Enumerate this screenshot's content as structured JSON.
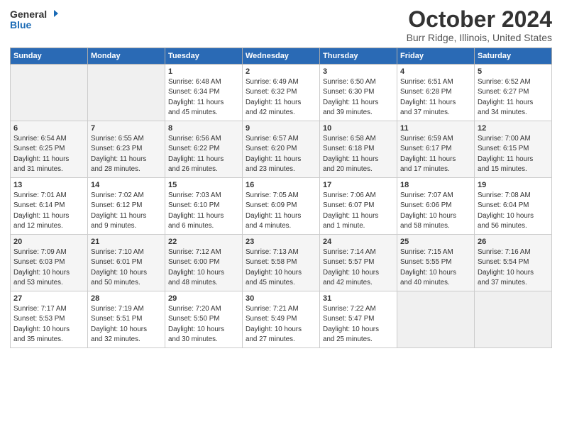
{
  "logo": {
    "line1": "General",
    "line2": "Blue"
  },
  "title": "October 2024",
  "location": "Burr Ridge, Illinois, United States",
  "days_of_week": [
    "Sunday",
    "Monday",
    "Tuesday",
    "Wednesday",
    "Thursday",
    "Friday",
    "Saturday"
  ],
  "weeks": [
    [
      {
        "num": "",
        "info": ""
      },
      {
        "num": "",
        "info": ""
      },
      {
        "num": "1",
        "info": "Sunrise: 6:48 AM\nSunset: 6:34 PM\nDaylight: 11 hours\nand 45 minutes."
      },
      {
        "num": "2",
        "info": "Sunrise: 6:49 AM\nSunset: 6:32 PM\nDaylight: 11 hours\nand 42 minutes."
      },
      {
        "num": "3",
        "info": "Sunrise: 6:50 AM\nSunset: 6:30 PM\nDaylight: 11 hours\nand 39 minutes."
      },
      {
        "num": "4",
        "info": "Sunrise: 6:51 AM\nSunset: 6:28 PM\nDaylight: 11 hours\nand 37 minutes."
      },
      {
        "num": "5",
        "info": "Sunrise: 6:52 AM\nSunset: 6:27 PM\nDaylight: 11 hours\nand 34 minutes."
      }
    ],
    [
      {
        "num": "6",
        "info": "Sunrise: 6:54 AM\nSunset: 6:25 PM\nDaylight: 11 hours\nand 31 minutes."
      },
      {
        "num": "7",
        "info": "Sunrise: 6:55 AM\nSunset: 6:23 PM\nDaylight: 11 hours\nand 28 minutes."
      },
      {
        "num": "8",
        "info": "Sunrise: 6:56 AM\nSunset: 6:22 PM\nDaylight: 11 hours\nand 26 minutes."
      },
      {
        "num": "9",
        "info": "Sunrise: 6:57 AM\nSunset: 6:20 PM\nDaylight: 11 hours\nand 23 minutes."
      },
      {
        "num": "10",
        "info": "Sunrise: 6:58 AM\nSunset: 6:18 PM\nDaylight: 11 hours\nand 20 minutes."
      },
      {
        "num": "11",
        "info": "Sunrise: 6:59 AM\nSunset: 6:17 PM\nDaylight: 11 hours\nand 17 minutes."
      },
      {
        "num": "12",
        "info": "Sunrise: 7:00 AM\nSunset: 6:15 PM\nDaylight: 11 hours\nand 15 minutes."
      }
    ],
    [
      {
        "num": "13",
        "info": "Sunrise: 7:01 AM\nSunset: 6:14 PM\nDaylight: 11 hours\nand 12 minutes."
      },
      {
        "num": "14",
        "info": "Sunrise: 7:02 AM\nSunset: 6:12 PM\nDaylight: 11 hours\nand 9 minutes."
      },
      {
        "num": "15",
        "info": "Sunrise: 7:03 AM\nSunset: 6:10 PM\nDaylight: 11 hours\nand 6 minutes."
      },
      {
        "num": "16",
        "info": "Sunrise: 7:05 AM\nSunset: 6:09 PM\nDaylight: 11 hours\nand 4 minutes."
      },
      {
        "num": "17",
        "info": "Sunrise: 7:06 AM\nSunset: 6:07 PM\nDaylight: 11 hours\nand 1 minute."
      },
      {
        "num": "18",
        "info": "Sunrise: 7:07 AM\nSunset: 6:06 PM\nDaylight: 10 hours\nand 58 minutes."
      },
      {
        "num": "19",
        "info": "Sunrise: 7:08 AM\nSunset: 6:04 PM\nDaylight: 10 hours\nand 56 minutes."
      }
    ],
    [
      {
        "num": "20",
        "info": "Sunrise: 7:09 AM\nSunset: 6:03 PM\nDaylight: 10 hours\nand 53 minutes."
      },
      {
        "num": "21",
        "info": "Sunrise: 7:10 AM\nSunset: 6:01 PM\nDaylight: 10 hours\nand 50 minutes."
      },
      {
        "num": "22",
        "info": "Sunrise: 7:12 AM\nSunset: 6:00 PM\nDaylight: 10 hours\nand 48 minutes."
      },
      {
        "num": "23",
        "info": "Sunrise: 7:13 AM\nSunset: 5:58 PM\nDaylight: 10 hours\nand 45 minutes."
      },
      {
        "num": "24",
        "info": "Sunrise: 7:14 AM\nSunset: 5:57 PM\nDaylight: 10 hours\nand 42 minutes."
      },
      {
        "num": "25",
        "info": "Sunrise: 7:15 AM\nSunset: 5:55 PM\nDaylight: 10 hours\nand 40 minutes."
      },
      {
        "num": "26",
        "info": "Sunrise: 7:16 AM\nSunset: 5:54 PM\nDaylight: 10 hours\nand 37 minutes."
      }
    ],
    [
      {
        "num": "27",
        "info": "Sunrise: 7:17 AM\nSunset: 5:53 PM\nDaylight: 10 hours\nand 35 minutes."
      },
      {
        "num": "28",
        "info": "Sunrise: 7:19 AM\nSunset: 5:51 PM\nDaylight: 10 hours\nand 32 minutes."
      },
      {
        "num": "29",
        "info": "Sunrise: 7:20 AM\nSunset: 5:50 PM\nDaylight: 10 hours\nand 30 minutes."
      },
      {
        "num": "30",
        "info": "Sunrise: 7:21 AM\nSunset: 5:49 PM\nDaylight: 10 hours\nand 27 minutes."
      },
      {
        "num": "31",
        "info": "Sunrise: 7:22 AM\nSunset: 5:47 PM\nDaylight: 10 hours\nand 25 minutes."
      },
      {
        "num": "",
        "info": ""
      },
      {
        "num": "",
        "info": ""
      }
    ]
  ]
}
